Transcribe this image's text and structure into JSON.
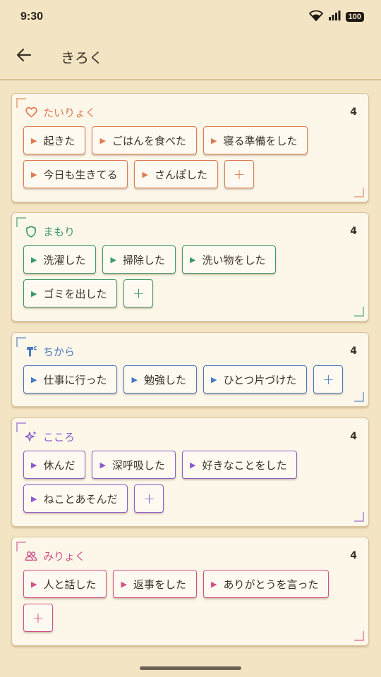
{
  "status_bar": {
    "time": "9:30",
    "battery": "100"
  },
  "app_bar": {
    "title": "きろく"
  },
  "sections": [
    {
      "id": "tairyoku",
      "title": "たいりょく",
      "count": "4",
      "color": "#e07a4d",
      "icon": "heart-icon",
      "items": [
        "起きた",
        "ごはんを食べた",
        "寝る準備をした",
        "今日も生きてる",
        "さんぽした"
      ],
      "add_label": "+"
    },
    {
      "id": "mamori",
      "title": "まもり",
      "count": "4",
      "color": "#3f9a66",
      "icon": "shield-icon",
      "items": [
        "洗濯した",
        "掃除した",
        "洗い物をした",
        "ゴミを出した"
      ],
      "add_label": "+"
    },
    {
      "id": "chikara",
      "title": "ちから",
      "count": "4",
      "color": "#4a78c2",
      "icon": "hammer-icon",
      "items": [
        "仕事に行った",
        "勉強した",
        "ひとつ片づけた"
      ],
      "add_label": "+"
    },
    {
      "id": "kokoro",
      "title": "こころ",
      "count": "4",
      "color": "#8b5ccc",
      "icon": "sparkle-icon",
      "items": [
        "休んだ",
        "深呼吸した",
        "好きなことをした",
        "ねことあそんだ"
      ],
      "add_label": "+"
    },
    {
      "id": "miryoku",
      "title": "みりょく",
      "count": "4",
      "color": "#d24f87",
      "icon": "people-icon",
      "items": [
        "人と話した",
        "返事をした",
        "ありがとうを言った"
      ],
      "add_label": "+"
    }
  ]
}
